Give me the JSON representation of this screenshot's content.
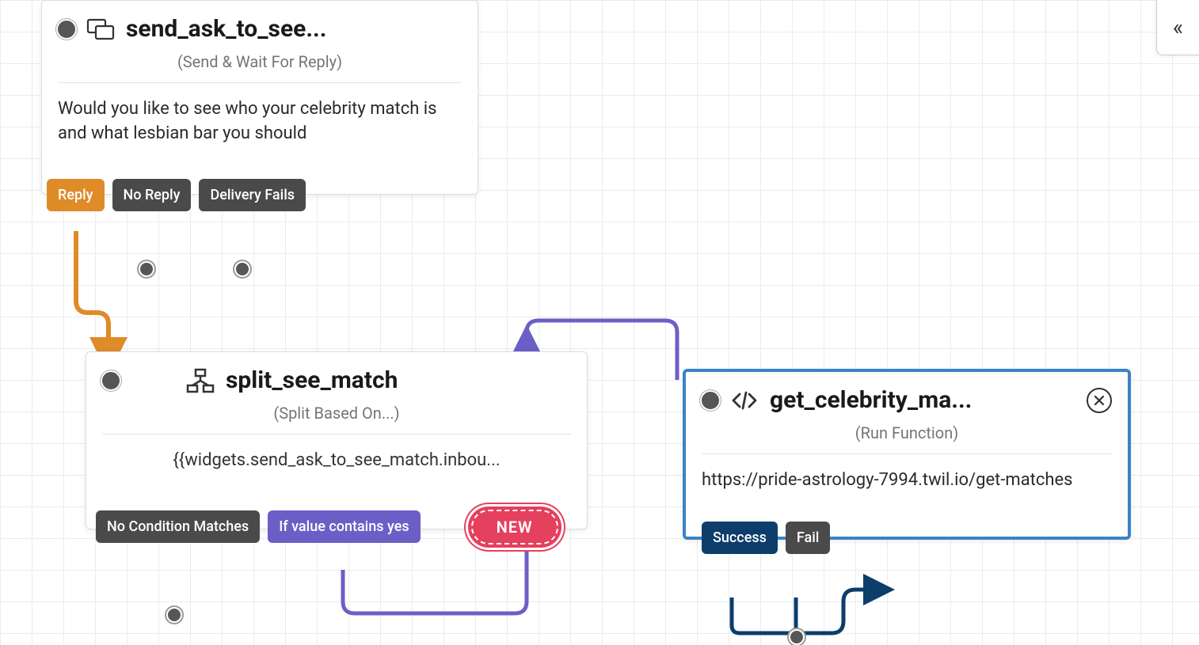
{
  "collapse_button": "«",
  "widget1": {
    "title": "send_ask_to_see...",
    "subtitle": "(Send & Wait For Reply)",
    "body": "Would you like to see who your celebrity match is and what lesbian bar you should",
    "transitions": {
      "reply": "Reply",
      "noreply": "No Reply",
      "fails": "Delivery Fails"
    }
  },
  "widget2": {
    "title": "split_see_match",
    "subtitle": "(Split Based On...)",
    "body": "{{widgets.send_ask_to_see_match.inbou...",
    "transitions": {
      "nocond": "No Condition Matches",
      "ifval": "If value contains yes",
      "new": "NEW"
    }
  },
  "widget3": {
    "title": "get_celebrity_ma...",
    "subtitle": "(Run Function)",
    "body": "https://pride-astrology-7994.twil.io/get-matches",
    "transitions": {
      "success": "Success",
      "fail": "Fail"
    }
  }
}
